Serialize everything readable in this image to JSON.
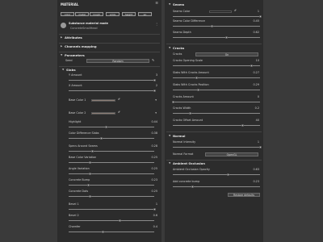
{
  "left_panel": {
    "title": "MATERIAL",
    "tags": [
      "color",
      "metal",
      "rough",
      "emis",
      "height",
      "ao"
    ],
    "material": {
      "name": "Substance material mode",
      "sub": "ConcreteSmallHead"
    },
    "sections": {
      "attributes": "Attributes",
      "channels": "Channels mapping",
      "parameters": "Parameters"
    },
    "seed": {
      "label": "Seed",
      "button": "Random"
    },
    "slabs_header": "Slabs",
    "params": [
      {
        "label": "Y Amount",
        "value": "3",
        "fraction": 1.0
      },
      {
        "label": "X Amount",
        "value": "2",
        "fraction": 1.0
      },
      {
        "label": "Base Color 1",
        "value": "",
        "swatch": true
      },
      {
        "label": "Base Color 2",
        "value": "",
        "swatch": true
      },
      {
        "label": "Highlight",
        "value": "0.44",
        "fraction": 0.44
      },
      {
        "label": "Color Difference Slabs",
        "value": "0.38",
        "fraction": 0.38
      },
      {
        "label": "Specs Around Seams",
        "value": "0.28",
        "fraction": 0.28
      },
      {
        "label": "Base Color Variation",
        "value": "0.25",
        "fraction": 0.25
      },
      {
        "label": "Angle Variation",
        "value": "0.25",
        "fraction": 0.25
      },
      {
        "label": "Concrete Bump",
        "value": "0.23",
        "fraction": 0.23
      },
      {
        "label": "Concrete Dots",
        "value": "0.25",
        "fraction": 0.25
      },
      {
        "label": "Bevel 1",
        "value": "1",
        "fraction": 1.0
      },
      {
        "label": "Bevel 2",
        "value": "0.6",
        "fraction": 0.6
      },
      {
        "label": "Chamfer",
        "value": "0.4",
        "fraction": 0.4
      }
    ]
  },
  "right_panel": {
    "seams_header": "Seams",
    "seams": [
      {
        "label": "Seams Color",
        "value": "1",
        "swatch": true,
        "fraction": 1.0
      },
      {
        "label": "Seams Color Difference",
        "value": "0.45",
        "fraction": 0.45
      },
      {
        "label": "Seams Depth",
        "value": "0.62",
        "fraction": 0.62
      }
    ],
    "cracks_header": "Cracks",
    "cracks_toggle": {
      "label": "Cracks",
      "button": "On"
    },
    "cracks": [
      {
        "label": "Cracks Opening Scale",
        "value": "10",
        "fraction": 0.9
      },
      {
        "label": "Slabs With Cracks Amount",
        "value": "0.27",
        "fraction": 0.27
      },
      {
        "label": "Slabs With Cracks Position",
        "value": "0.29",
        "fraction": 0.29
      },
      {
        "label": "Cracks Amount",
        "value": "0",
        "fraction": 0.0
      },
      {
        "label": "Cracks Width",
        "value": "0.2",
        "fraction": 0.2
      },
      {
        "label": "Cracks Offset Amount",
        "value": "40",
        "fraction": 0.8
      }
    ],
    "normal_header": "Normal",
    "normal_intensity": {
      "label": "Normal Intensity",
      "value": "1",
      "fraction": 1.0
    },
    "normal_format": {
      "label": "Normal Format",
      "button": "OpenGL"
    },
    "ao_header": "Ambient Occlusion",
    "ao": [
      {
        "label": "Ambient Occlusion Opacity",
        "value": "0.63",
        "fraction": 0.63
      },
      {
        "label": "Add concrete bump",
        "value": "0.23",
        "fraction": 0.23
      }
    ],
    "restore_button": "Restore defaults"
  }
}
